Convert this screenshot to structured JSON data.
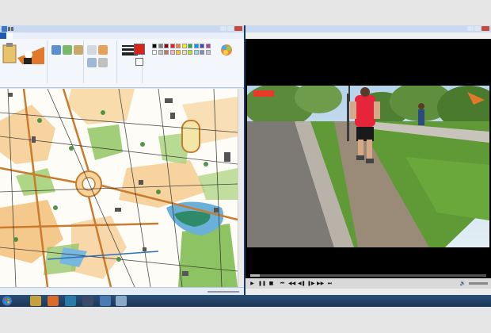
{
  "paint": {
    "title": "",
    "file_tab": "",
    "tabs": [
      "",
      ""
    ],
    "status": {
      "cursor": "",
      "selection": "",
      "size": "",
      "zoom": ""
    }
  },
  "player": {
    "title": "",
    "menu": [
      "",
      "",
      "",
      "",
      "",
      ""
    ],
    "status": "",
    "progress": 0.04,
    "video_logo": "",
    "video_corner_text": ""
  },
  "taskbar": {
    "lang": "",
    "time": "",
    "date": ""
  },
  "watermark": "",
  "colors": {
    "paint_accent": "#1c5bb0",
    "map_green": "#8cc25a",
    "map_orange": "#f2b768",
    "map_blue": "#6ab0d8",
    "taskbar": "#1b3656"
  }
}
